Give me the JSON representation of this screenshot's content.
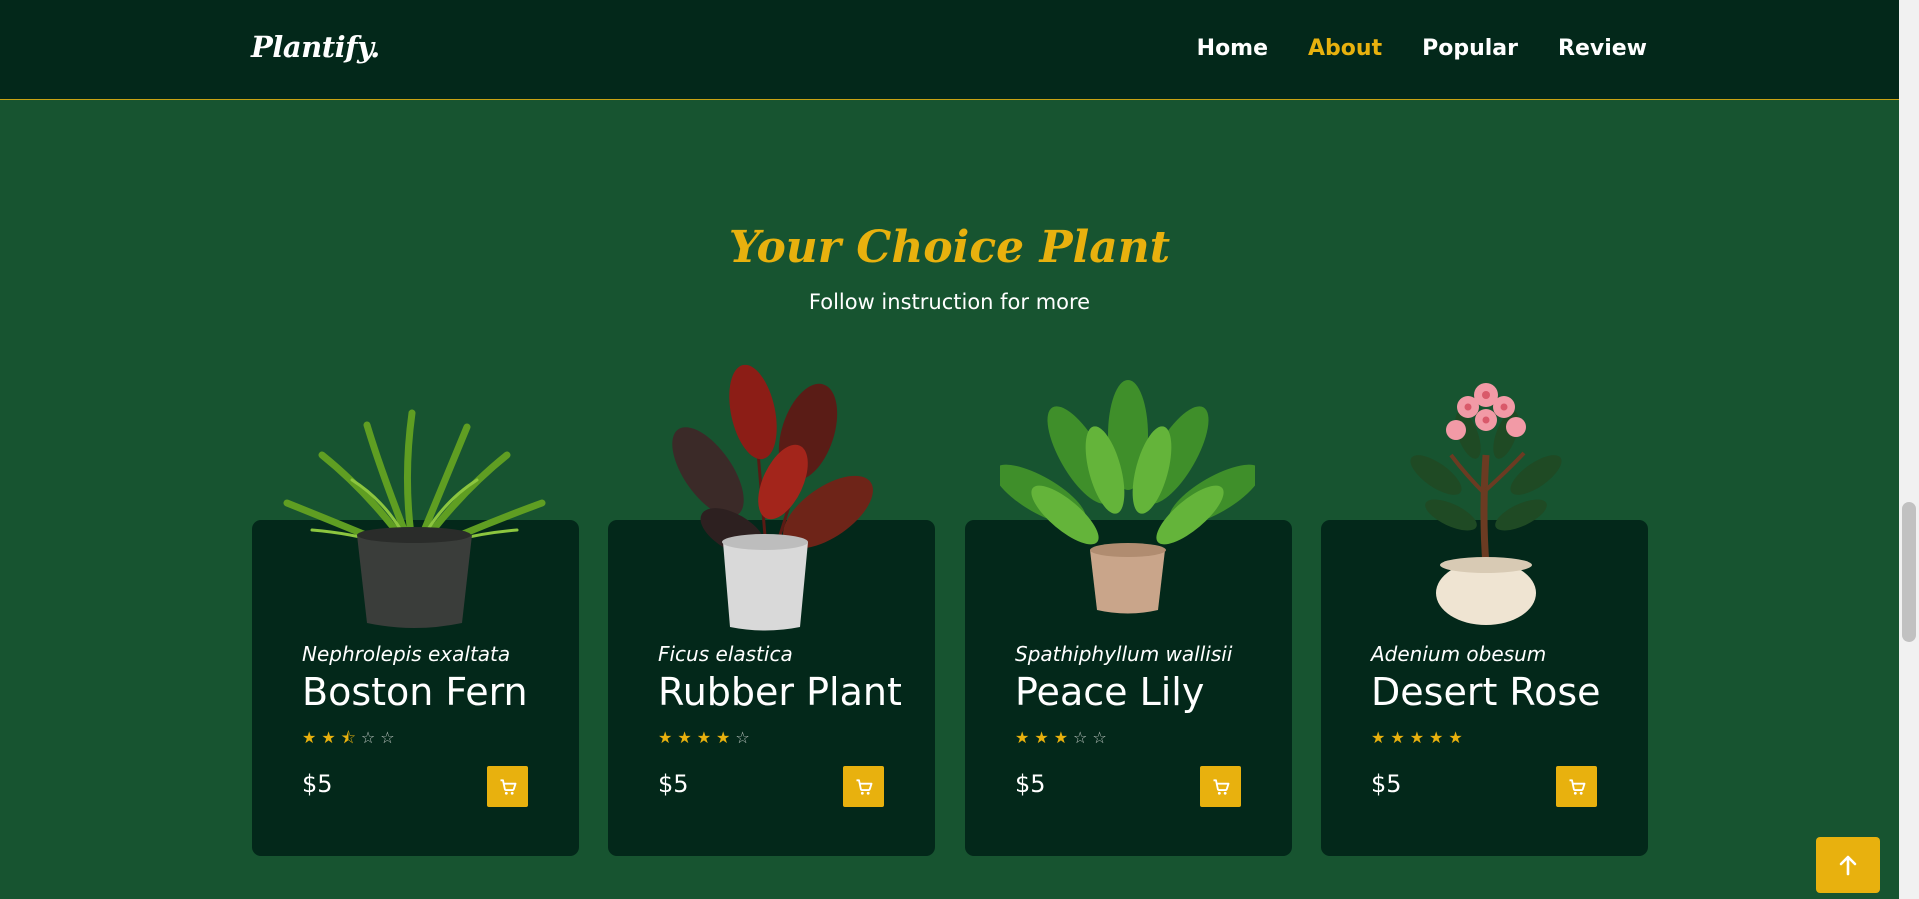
{
  "header": {
    "logo": "Plantify.",
    "nav": [
      {
        "label": "Home",
        "active": false
      },
      {
        "label": "About",
        "active": true
      },
      {
        "label": "Popular",
        "active": false
      },
      {
        "label": "Review",
        "active": false
      }
    ]
  },
  "section": {
    "title": "Your Choice Plant",
    "subtitle": "Follow instruction for more"
  },
  "products": [
    {
      "scientific_name": "Nephrolepis exaltata",
      "name": "Boston Fern",
      "rating": 2.5,
      "price": "$5",
      "image": "fern-plant-image"
    },
    {
      "scientific_name": "Ficus elastica",
      "name": "Rubber Plant",
      "rating": 4,
      "price": "$5",
      "image": "rubber-plant-image"
    },
    {
      "scientific_name": "Spathiphyllum wallisii",
      "name": "Peace Lily",
      "rating": 3,
      "price": "$5",
      "image": "peace-lily-image"
    },
    {
      "scientific_name": "Adenium obesum",
      "name": "Desert Rose",
      "rating": 5,
      "price": "$5",
      "image": "desert-rose-image"
    }
  ],
  "icons": {
    "cart": "cart-icon",
    "scroll_top": "arrow-up-icon"
  },
  "colors": {
    "background": "#175430",
    "header": "#03281a",
    "card": "#03281a",
    "accent": "#e8b10e",
    "text": "#ffffff"
  }
}
